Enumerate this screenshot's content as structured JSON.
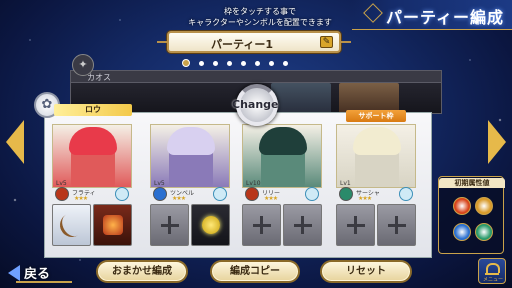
{
  "screen": {
    "title": "パーティー編成"
  },
  "instruction": {
    "line1": "枠をタッチする事で",
    "line2": "キャラクターやシンボルを配置できます"
  },
  "party": {
    "name": "パーティー1",
    "page_count": 8,
    "active_index": 0
  },
  "back_party": {
    "label": "カオス"
  },
  "leader_label": "ロウ",
  "support_label": "サポート枠",
  "change_label": "Change",
  "slots": [
    {
      "level": "Lv5",
      "name": "フラティ",
      "stars": "★★★",
      "portrait_color": "#e05a5a",
      "hair_color": "#e83a4a",
      "element_color": "#b8361a",
      "equips": [
        "bow",
        "fire"
      ]
    },
    {
      "level": "Lv5",
      "name": "ツンベル",
      "stars": "★★★",
      "portrait_color": "#8a7ab8",
      "hair_color": "#d8d0f0",
      "element_color": "#2a6fd0",
      "equips": [
        "empty",
        "gem"
      ]
    },
    {
      "level": "Lv10",
      "name": "リリー",
      "stars": "★★★",
      "portrait_color": "#5a8a7a",
      "hair_color": "#1f3f3a",
      "element_color": "#b8361a",
      "equips": [
        "empty",
        "empty"
      ]
    },
    {
      "level": "Lv1",
      "name": "サーシャ",
      "stars": "★★★",
      "portrait_color": "#d8d4c4",
      "hair_color": "#f2ecd0",
      "element_color": "#2a8a6a",
      "equips": [
        "empty",
        "empty"
      ]
    }
  ],
  "attribute_panel": {
    "title": "初期属性値",
    "elements": [
      {
        "name": "fire",
        "color": "#d8441a"
      },
      {
        "name": "earth",
        "color": "#d89a2a"
      },
      {
        "name": "water",
        "color": "#2a6fd0"
      },
      {
        "name": "wind",
        "color": "#2a9a6a"
      }
    ]
  },
  "buttons": {
    "back": "戻る",
    "auto": "おまかせ編成",
    "copy": "編成コピー",
    "reset": "リセット",
    "menu": "メニュー"
  },
  "colors": {
    "accent_gold": "#c9a24a",
    "background_blue": "#142a66"
  }
}
